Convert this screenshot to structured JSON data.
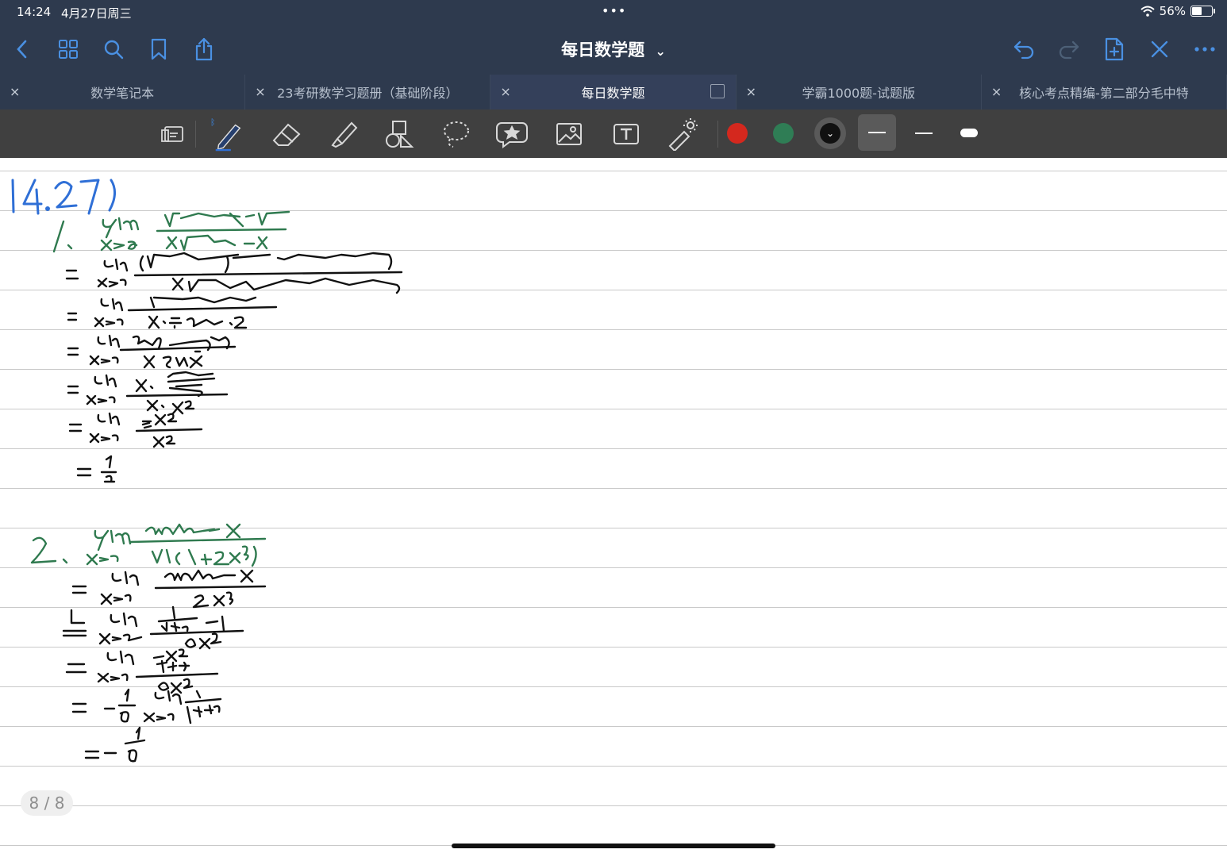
{
  "status": {
    "time": "14:24",
    "date": "4月27日周三",
    "battery": "56%"
  },
  "header": {
    "title": "每日数学题",
    "title_chevron": "⌄"
  },
  "nav_icons_left": [
    "back-icon",
    "grid-icon",
    "search-icon",
    "bookmark-icon",
    "share-icon"
  ],
  "nav_icons_right": [
    "undo-icon",
    "redo-icon",
    "add-page-icon",
    "close-app-icon",
    "more-icon"
  ],
  "tabs": [
    {
      "label": "数学笔记本",
      "active": false
    },
    {
      "label": "23考研数学习题册（基础阶段）",
      "active": false
    },
    {
      "label": "每日数学题",
      "active": true
    },
    {
      "label": "学霸1000题-试题版",
      "active": false
    },
    {
      "label": "核心考点精编-第二部分毛中特",
      "active": false
    }
  ],
  "tab_close": "×",
  "toolbar": {
    "tools": [
      "read-mode-icon",
      "pen-icon",
      "eraser-icon",
      "highlighter-icon",
      "shapes-icon",
      "lasso-icon",
      "sticker-icon",
      "image-icon",
      "text-icon",
      "laser-pointer-icon"
    ],
    "colors": {
      "red": "#d4281e",
      "green": "#2f7d55",
      "black": "#111111"
    }
  },
  "colors": {
    "ink_blue": "#2f6fd6",
    "ink_green": "#2f7a4f",
    "ink_black": "#111111",
    "nav_bg": "#2e3a4e",
    "toolbar_bg": "#404040"
  },
  "page": {
    "indicator": "8 / 8"
  }
}
